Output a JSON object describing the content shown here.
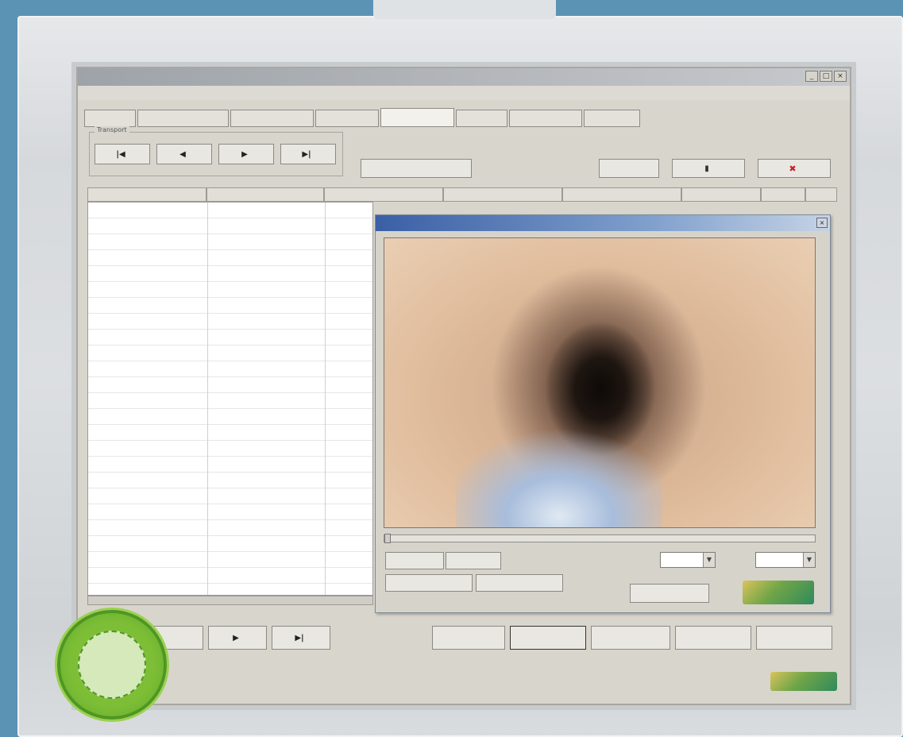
{
  "window": {
    "title": "",
    "subtitle": ""
  },
  "tabs": [
    "",
    "",
    "",
    "",
    "",
    "",
    "",
    "",
    ""
  ],
  "toolbar": {
    "transport_label": "Transport",
    "nav_buttons": [
      "",
      "",
      "",
      ""
    ],
    "info_text": "",
    "play_button": "",
    "save_button": "",
    "help_button": "",
    "delete_button": ""
  },
  "grid": {
    "headers": [
      "",
      "",
      "",
      "",
      "",
      "",
      "",
      ""
    ],
    "rows": [
      [
        "",
        "",
        ""
      ],
      [
        "",
        "",
        ""
      ],
      [
        "",
        "",
        ""
      ],
      [
        "",
        "",
        ""
      ],
      [
        "",
        "",
        ""
      ],
      [
        "",
        "",
        ""
      ],
      [
        "",
        "",
        ""
      ],
      [
        "",
        "",
        ""
      ],
      [
        "",
        "",
        ""
      ],
      [
        "",
        "",
        ""
      ]
    ]
  },
  "video_dialog": {
    "title": "",
    "overlay_top": "",
    "overlay_bottom": "",
    "btn_1": "",
    "btn_2": "",
    "btn_3": "",
    "btn_4": "",
    "speed_label": "",
    "speed_value": "",
    "size_label": "",
    "size_value": "",
    "settings_button": "",
    "progress": 0.0
  },
  "bottom": {
    "status_text": "",
    "nav_buttons": [
      "",
      "",
      ""
    ],
    "action_buttons": [
      "",
      "",
      "",
      "",
      ""
    ]
  },
  "badge": {
    "line1": "",
    "line2": "",
    "line3": ""
  },
  "colors": {
    "background": "#5b93b5",
    "window": "#d8d5cd",
    "title_gradient_start": "#3a5fa5",
    "badge_green": "#7bbd35"
  },
  "icons": {
    "first": "skip-to-start-icon",
    "prev": "step-back-icon",
    "next": "step-forward-icon",
    "last": "skip-to-end-icon",
    "save": "save-icon",
    "delete": "delete-icon"
  }
}
